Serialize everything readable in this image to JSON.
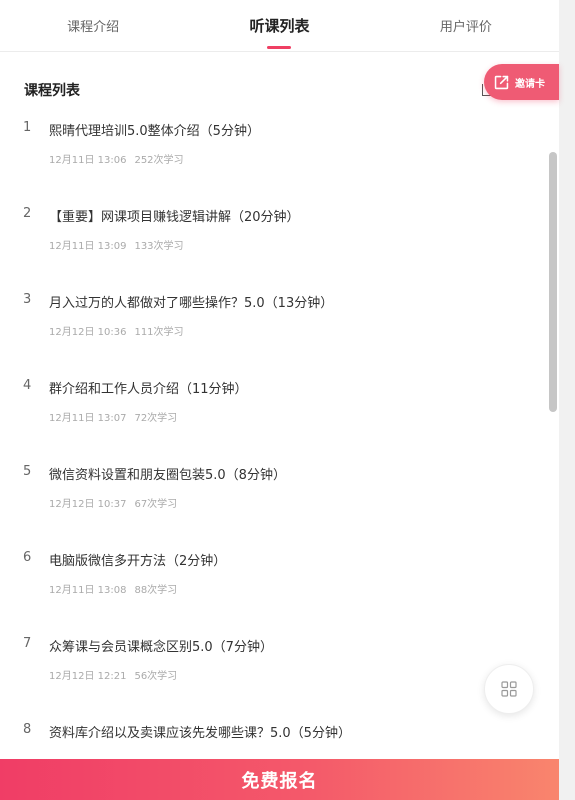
{
  "tabs": [
    {
      "label": "课程介绍",
      "active": false
    },
    {
      "label": "听课列表",
      "active": true
    },
    {
      "label": "用户评价",
      "active": false
    }
  ],
  "section": {
    "title": "课程列表"
  },
  "invite": {
    "label": "邀请卡",
    "icon": "share-edit-icon"
  },
  "lessons": [
    {
      "index": "1",
      "title": "熙晴代理培训5.0整体介绍（5分钟）",
      "date": "12月11日 13:06",
      "views": "252次学习"
    },
    {
      "index": "2",
      "title": "【重要】网课项目赚钱逻辑讲解（20分钟）",
      "date": "12月11日 13:09",
      "views": "133次学习"
    },
    {
      "index": "3",
      "title": "月入过万的人都做对了哪些操作？5.0（13分钟）",
      "date": "12月12日 10:36",
      "views": "111次学习"
    },
    {
      "index": "4",
      "title": "群介绍和工作人员介绍（11分钟）",
      "date": "12月11日 13:07",
      "views": "72次学习"
    },
    {
      "index": "5",
      "title": "微信资料设置和朋友圈包装5.0（8分钟）",
      "date": "12月12日 10:37",
      "views": "67次学习"
    },
    {
      "index": "6",
      "title": "电脑版微信多开方法（2分钟）",
      "date": "12月11日 13:08",
      "views": "88次学习"
    },
    {
      "index": "7",
      "title": "众筹课与会员课概念区别5.0（7分钟）",
      "date": "12月12日 12:21",
      "views": "56次学习"
    },
    {
      "index": "8",
      "title": "资料库介绍以及卖课应该先发哪些课？5.0（5分钟）",
      "date": "",
      "views": ""
    }
  ],
  "bottom": {
    "label": "免费报名"
  },
  "colors": {
    "accent": "#ef3f63",
    "invite": "#ef5b74",
    "gradient_end": "#f9856d"
  }
}
